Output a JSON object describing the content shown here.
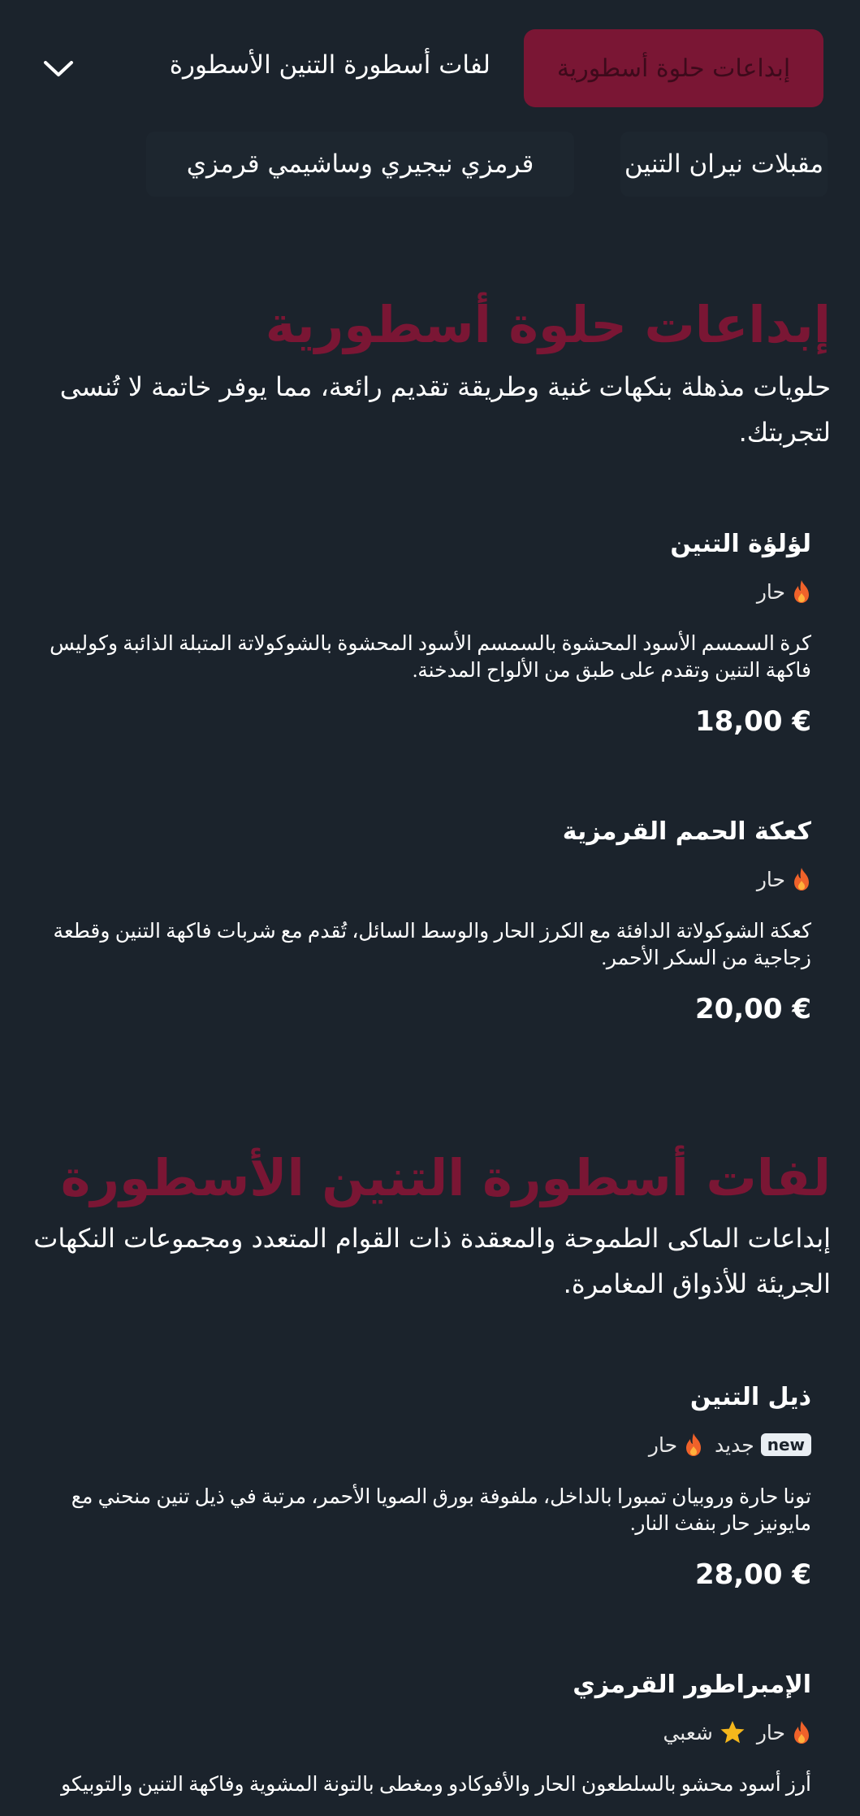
{
  "nav": {
    "active_tab": "إبداعات حلوة أسطورية",
    "tab_2": "لفات أسطورة التنين الأسطورة",
    "sub_tabs": [
      "مقبلات نيران التنين",
      "قرمزي نيجيري وساشيمي قرمزي"
    ]
  },
  "sections": [
    {
      "title": "إبداعات حلوة أسطورية",
      "description": "حلويات مذهلة بنكهات غنية وطريقة تقديم رائعة، مما يوفر خاتمة لا تُنسى لتجربتك.",
      "items": [
        {
          "name": "لؤلؤة التنين",
          "tags": [
            {
              "label": "حار",
              "icon": "flame-icon"
            }
          ],
          "description": "كرة السمسم الأسود المحشوة بالسمسم الأسود المحشوة بالشوكولاتة المتبلة الذائبة وكوليس فاكهة التنين وتقدم على طبق من الألواح المدخنة.",
          "price": "18,00 €"
        },
        {
          "name": "كعكة الحمم القرمزية",
          "tags": [
            {
              "label": "حار",
              "icon": "flame-icon"
            }
          ],
          "description": "كعكة الشوكولاتة الدافئة مع الكرز الحار والوسط السائل، تُقدم مع شربات فاكهة التنين وقطعة زجاجية من السكر الأحمر.",
          "price": "20,00 €"
        }
      ]
    },
    {
      "title": "لفات أسطورة التنين الأسطورة",
      "description": "إبداعات الماكى الطموحة والمعقدة ذات القوام المتعدد ومجموعات النكهات الجريئة للأذواق المغامرة.",
      "items": [
        {
          "name": "ذيل التنين",
          "badge": "new",
          "tags": [
            {
              "label": "جديد",
              "icon": "new-badge"
            },
            {
              "label": "حار",
              "icon": "flame-icon"
            }
          ],
          "description": "تونا حارة وروبيان تمبورا بالداخل، ملفوفة بورق الصويا الأحمر، مرتبة في ذيل تنين منحني مع مايونيز حار بنفث النار.",
          "price": "28,00 €"
        },
        {
          "name": "الإمبراطور القرمزي",
          "tags": [
            {
              "label": "حار",
              "icon": "flame-icon"
            },
            {
              "label": "شعبي",
              "icon": "star-icon"
            }
          ],
          "description": "أرز أسود محشو بالسلطعون الحار والأفوكادو ومغطى بالتونة المشوية وفاكهة التنين والتوبيكو",
          "price": ""
        }
      ]
    }
  ],
  "colors": {
    "background": "#1b232c",
    "accent": "#7a1634",
    "flame": "#f0622a",
    "star": "#f5b71c"
  }
}
